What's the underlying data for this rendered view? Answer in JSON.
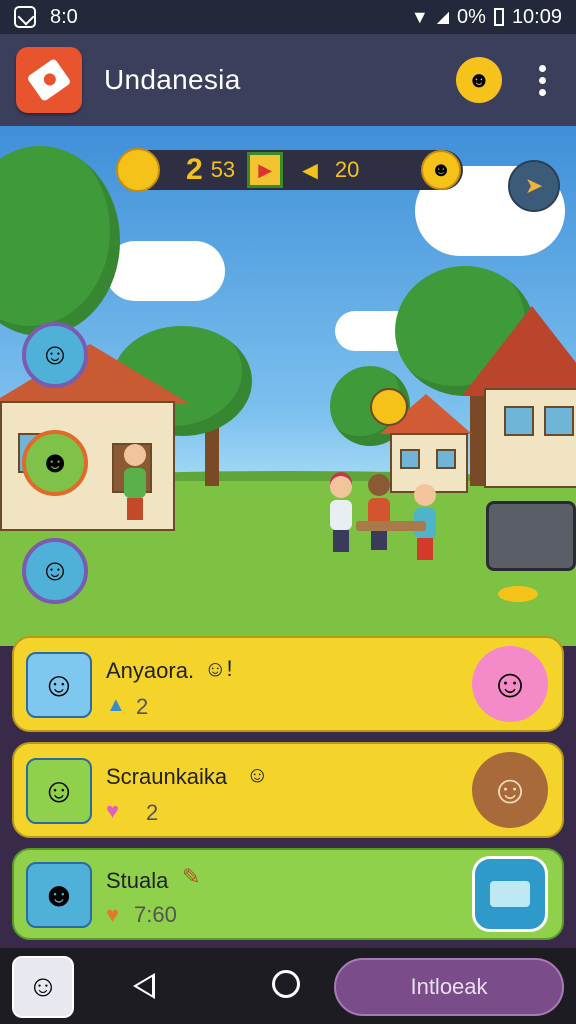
{
  "status_bar": {
    "left_text": "8:0",
    "battery": "0%",
    "time": "10:09"
  },
  "app_bar": {
    "title": "Undanesia",
    "mascot_icon": "ghost-mascot-icon",
    "menu_icon": "kebab-menu-icon"
  },
  "resources": {
    "coin_value": "2",
    "coin_sub_value": "53",
    "trophy_value": "20"
  },
  "friends": [
    {
      "name": "Anyaora.",
      "name_icon": "☺!",
      "stat_icon": "shield-icon",
      "stat": "2",
      "card_color": "#f4d42b"
    },
    {
      "name": "Scraunkaika",
      "name_icon": "☺",
      "stat_icon": "heart-icon",
      "stat": "2",
      "card_color": "#f4d42b"
    },
    {
      "name": "Stuala",
      "name_icon": "✎",
      "stat_icon": "heart-icon",
      "stat": "7:60",
      "card_color": "#8fd14b"
    }
  ],
  "nav_bar": {
    "action_button_label": "Intloeak"
  },
  "colors": {
    "accent_yellow": "#f4d42b",
    "accent_green": "#8fd14b",
    "nav_purple": "#7a4c8a",
    "app_bar": "#3b3f5c"
  }
}
